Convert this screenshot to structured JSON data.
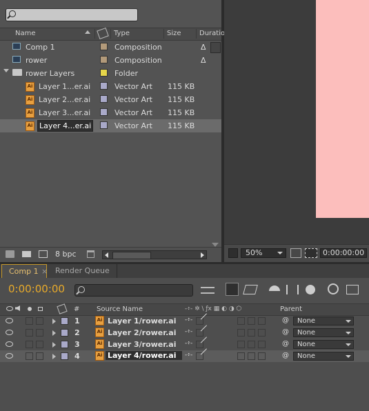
{
  "project": {
    "search": {
      "placeholder": ""
    },
    "columns": {
      "name": "Name",
      "type": "Type",
      "size": "Size",
      "duration": "Duratio"
    },
    "items": [
      {
        "name": "Comp 1",
        "type": "Composition",
        "size": "",
        "duration": "Δ",
        "icon": "composition-icon",
        "label_color": "#b29a7a"
      },
      {
        "name": "rower",
        "type": "Composition",
        "size": "",
        "duration": "Δ",
        "icon": "composition-icon",
        "label_color": "#b29a7a"
      },
      {
        "name": "rower Layers",
        "type": "Folder",
        "size": "",
        "duration": "",
        "icon": "folder-icon",
        "label_color": "#e6d64a"
      },
      {
        "name": "Layer 1...er.ai",
        "type": "Vector Art",
        "size": "115 KB",
        "duration": "",
        "icon": "ai-file-icon",
        "label_color": "#a9a9c9"
      },
      {
        "name": "Layer 2...er.ai",
        "type": "Vector Art",
        "size": "115 KB",
        "duration": "",
        "icon": "ai-file-icon",
        "label_color": "#a9a9c9"
      },
      {
        "name": "Layer 3...er.ai",
        "type": "Vector Art",
        "size": "115 KB",
        "duration": "",
        "icon": "ai-file-icon",
        "label_color": "#a9a9c9"
      },
      {
        "name": "Layer 4...er.ai",
        "type": "Vector Art",
        "size": "115 KB",
        "duration": "",
        "icon": "ai-file-icon",
        "label_color": "#a9a9c9",
        "selected": true
      }
    ],
    "bpc": "8 bpc"
  },
  "viewer": {
    "zoom": "50%",
    "timecode": "0:00:00:00"
  },
  "timeline": {
    "tabs": [
      {
        "label": "Comp 1",
        "active": true
      },
      {
        "label": "Render Queue",
        "active": false
      }
    ],
    "timecode": "0:00:00:00",
    "columns": {
      "num": "#",
      "source_name": "Source Name",
      "parent": "Parent"
    },
    "layers": [
      {
        "num": "1",
        "name": "Layer 1/rower.ai",
        "parent": "None",
        "label_color": "#a9a9c9"
      },
      {
        "num": "2",
        "name": "Layer 2/rower.ai",
        "parent": "None",
        "label_color": "#a9a9c9"
      },
      {
        "num": "3",
        "name": "Layer 3/rower.ai",
        "parent": "None",
        "label_color": "#a9a9c9"
      },
      {
        "num": "4",
        "name": "Layer 4/rower.ai",
        "parent": "None",
        "label_color": "#a9a9c9",
        "selected": true
      }
    ]
  },
  "colors": {
    "timecode": "#e8aa2a",
    "viewer_background": "#fcbebc",
    "tab_highlight": "#c89a2a"
  }
}
